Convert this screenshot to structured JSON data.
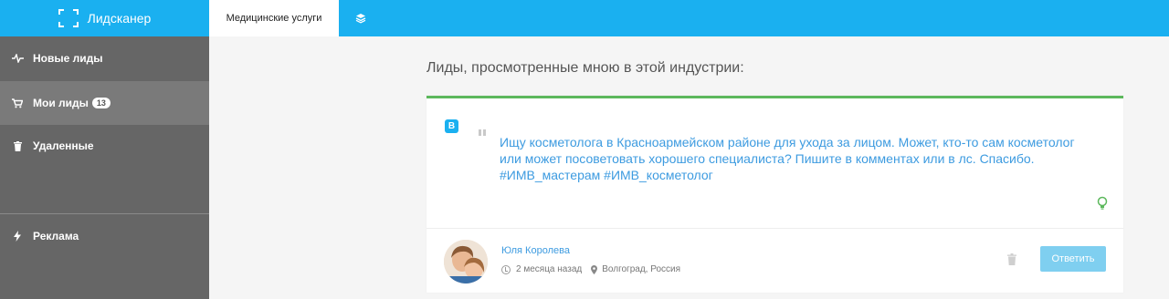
{
  "app": {
    "title": "Лидсканер"
  },
  "topbar": {
    "active_tab": "Медицинские услуги",
    "layers_icon": "layers-icon"
  },
  "sidebar": {
    "items": [
      {
        "label": "Новые лиды",
        "icon": "pulse-icon"
      },
      {
        "label": "Мои лиды",
        "icon": "cart-icon",
        "badge": "13"
      },
      {
        "label": "Удаленные",
        "icon": "trash-icon"
      },
      {
        "label": "Реклама",
        "icon": "lightning-icon"
      }
    ]
  },
  "main": {
    "heading": "Лиды, просмотренные мною в этой индустрии:",
    "lead": {
      "source_badge": "B",
      "text": "Ищу косметолога в Красноармейском районе для ухода за лицом. Может, кто-то сам косметолог или может посоветовать хорошего специалиста? Пишите в комментах или в лс. Спасибо. #ИМВ_мастерам #ИМВ_косметолог",
      "author": "Юля Королева",
      "time": "2 месяца назад",
      "location": "Волгоград, Россия",
      "reply_label": "Ответить"
    }
  },
  "colors": {
    "accent": "#1ab0f0",
    "sidebar_bg": "#666666",
    "card_border": "#5cb85c",
    "link": "#3d9be0",
    "reply_button": "#7fcff0"
  }
}
